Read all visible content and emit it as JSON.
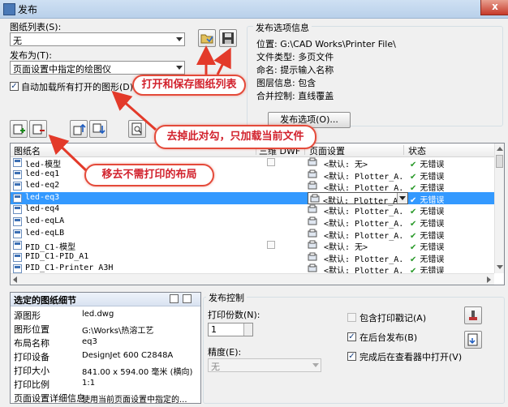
{
  "window": {
    "title": "发布",
    "close_label": "x"
  },
  "sheet_list": {
    "label": "图纸列表(S):",
    "value": "无",
    "open_icon": "folder-open-icon",
    "save_icon": "floppy-disk-icon"
  },
  "publish_to": {
    "label": "发布为(T):",
    "value": "页面设置中指定的绘图仪"
  },
  "auto_load": {
    "checked": true,
    "label": "自动加载所有打开的图形(D)"
  },
  "publish_options_info": {
    "title": "发布选项信息",
    "lines": [
      "位置: G:\\CAD Works\\Printer File\\",
      "文件类型: 多页文件",
      "命名: 提示输入名称",
      "图层信息: 包含",
      "合并控制: 直线覆盖"
    ],
    "button_label": "发布选项(O)..."
  },
  "toolbar_icons": [
    "add-sheet-icon",
    "remove-sheet-icon",
    "move-up-icon",
    "move-down-icon",
    "preview-icon"
  ],
  "table": {
    "columns": [
      "图纸名",
      "三维 DWF",
      "页面设置",
      "状态"
    ],
    "rows": [
      {
        "name": "led-模型",
        "has_3d": true,
        "setup": "<默认: 无>",
        "status": "无错误",
        "selected": false
      },
      {
        "name": "led-eq1",
        "has_3d": false,
        "setup": "<默认: Plotter_A...",
        "status": "无错误",
        "selected": false
      },
      {
        "name": "led-eq2",
        "has_3d": false,
        "setup": "<默认: Plotter_A...",
        "status": "无错误",
        "selected": false
      },
      {
        "name": "led-eq3",
        "has_3d": false,
        "setup": "<默认: Plotter_A1H",
        "status": "无错误",
        "selected": true
      },
      {
        "name": "led-eq4",
        "has_3d": false,
        "setup": "<默认: Plotter_A...",
        "status": "无错误",
        "selected": false
      },
      {
        "name": "led-eqLA",
        "has_3d": false,
        "setup": "<默认: Plotter_A...",
        "status": "无错误",
        "selected": false
      },
      {
        "name": "led-eqLB",
        "has_3d": false,
        "setup": "<默认: Plotter_A...",
        "status": "无错误",
        "selected": false
      },
      {
        "name": "PID_C1-模型",
        "has_3d": true,
        "setup": "<默认: 无>",
        "status": "无错误",
        "selected": false
      },
      {
        "name": "PID_C1-PID_A1",
        "has_3d": false,
        "setup": "<默认: Plotter_A...",
        "status": "无错误",
        "selected": false
      },
      {
        "name": "PID_C1-Printer A3H",
        "has_3d": false,
        "setup": "<默认: Plotter_A...",
        "status": "无错误",
        "selected": false
      }
    ]
  },
  "details": {
    "title": "选定的图纸细节",
    "rows": [
      {
        "label": "源图形",
        "value": "led.dwg"
      },
      {
        "label": "图形位置",
        "value": "G:\\Works\\热溶工艺"
      },
      {
        "label": "布局名称",
        "value": "eq3"
      },
      {
        "label": "打印设备",
        "value": "DesignJet 600 C2848A"
      },
      {
        "label": "打印大小",
        "value": "841.00 x 594.00 毫米 (横向)"
      },
      {
        "label": "打印比例",
        "value": "1:1"
      },
      {
        "label": "页面设置详细信息",
        "value": "使用当前页面设置中指定的..."
      }
    ]
  },
  "publish_control": {
    "title": "发布控制",
    "copies_label": "打印份数(N):",
    "copies_value": "1",
    "precision_label": "精度(E):",
    "precision_value": "无",
    "checkboxes": [
      {
        "label": "包含打印戳记(A)",
        "checked": false
      },
      {
        "label": "在后台发布(B)",
        "checked": true
      },
      {
        "label": "完成后在查看器中打开(V)",
        "checked": true
      }
    ],
    "stamp_icon": "plot-stamp-icon",
    "viewer_icon": "viewer-icon"
  },
  "annotations": {
    "open_save": "打开和保存图纸列表",
    "uncheck_load": "去掉此对勾，只加载当前文件",
    "remove_layout": "移去不需打印的布局"
  },
  "colors": {
    "selection": "#3399ff",
    "annotation": "#e44a3a",
    "ok_check": "#2a9a2a"
  }
}
